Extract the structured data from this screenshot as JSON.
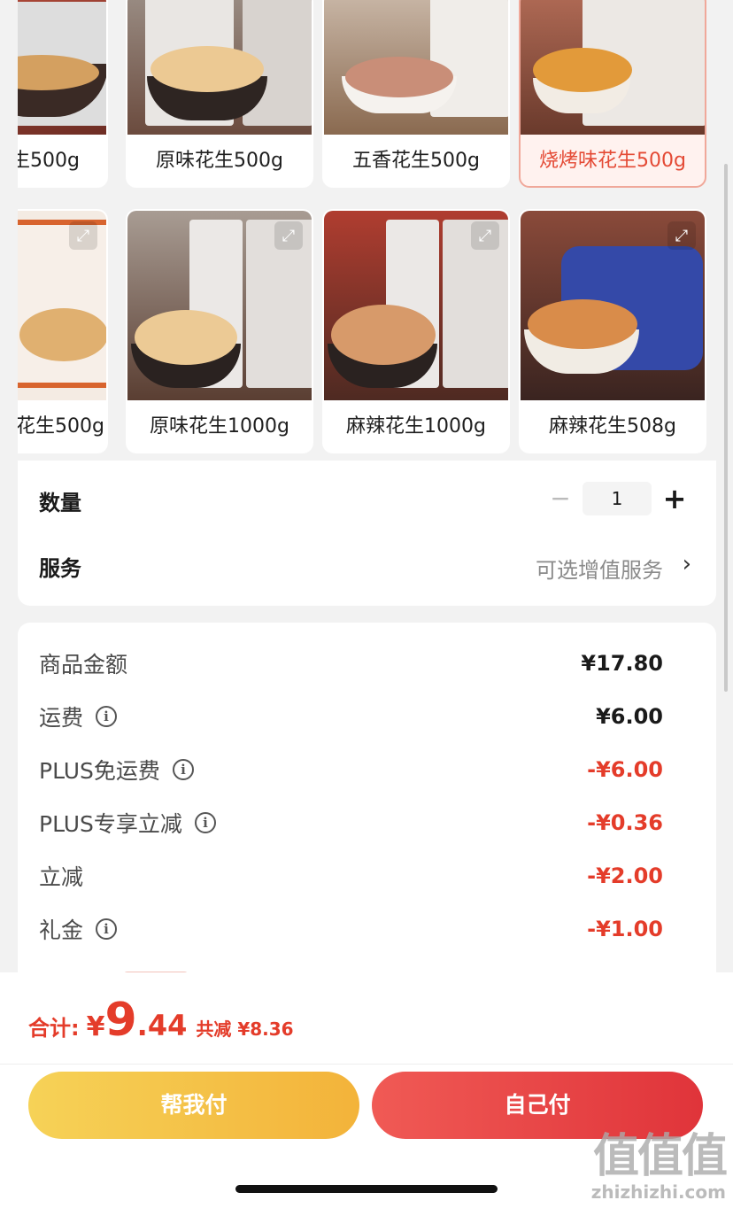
{
  "variants": [
    {
      "label": "生500g",
      "selected": false,
      "expand_icon": false
    },
    {
      "label": "原味花生500g",
      "selected": false,
      "expand_icon": false
    },
    {
      "label": "五香花生500g",
      "selected": false,
      "expand_icon": false
    },
    {
      "label": "烧烤味花生500g",
      "selected": true,
      "expand_icon": false
    },
    {
      "label": "花生500g",
      "selected": false,
      "expand_icon": true
    },
    {
      "label": "原味花生1000g",
      "selected": false,
      "expand_icon": true
    },
    {
      "label": "麻辣花生1000g",
      "selected": false,
      "expand_icon": true
    },
    {
      "label": "麻辣花生508g",
      "selected": false,
      "expand_icon": true
    }
  ],
  "quantity": {
    "label": "数量",
    "value": "1",
    "minus": "−",
    "plus": "+"
  },
  "service": {
    "label": "服务",
    "value": "可选增值服务",
    "chevron": "›"
  },
  "fees": [
    {
      "label": "商品金额",
      "value": "¥17.80",
      "info": false,
      "red": false
    },
    {
      "label": "运费",
      "value": "¥6.00",
      "info": true,
      "red": false
    },
    {
      "label": "PLUS免运费",
      "value": "-¥6.00",
      "info": true,
      "red": true
    },
    {
      "label": "PLUS专享立减",
      "value": "-¥0.36",
      "info": true,
      "red": true
    },
    {
      "label": "立减",
      "value": "-¥2.00",
      "info": false,
      "red": true
    },
    {
      "label": "礼金",
      "value": "-¥1.00",
      "info": true,
      "red": true
    }
  ],
  "info_glyph": "i",
  "expand_glyph": "⤢",
  "total": {
    "label": "合计:",
    "currency": "¥",
    "integer": "9",
    "decimal": ".44",
    "saved": "共减 ¥8.36"
  },
  "buttons": {
    "help_pay": "帮我付",
    "self_pay": "自己付"
  },
  "watermark": {
    "mark": "值值值",
    "url": "zhizhizhi.com"
  },
  "colors": {
    "accent_red": "#e43c2a",
    "yellow_btn": "#f4c245",
    "red_btn": "#e8423f"
  }
}
